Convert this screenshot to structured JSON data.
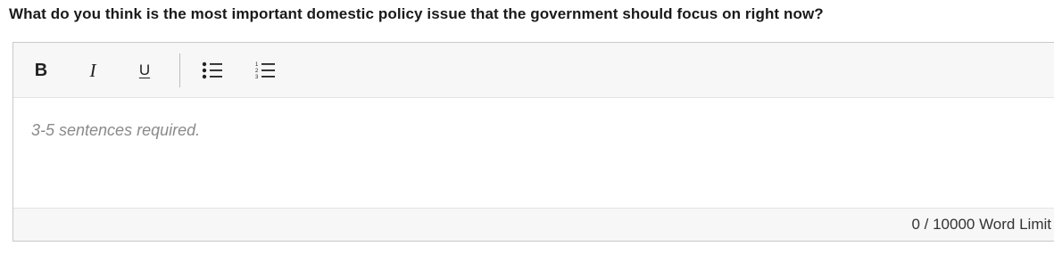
{
  "question": {
    "text": "What do you think is the most important domestic policy issue that the government should focus on right now?"
  },
  "toolbar": {
    "bold_label": "B",
    "italic_label": "I",
    "underline_label": "U",
    "bullet_list_icon": "bulleted-list-icon",
    "numbered_list_icon": "numbered-list-icon"
  },
  "editor": {
    "placeholder": "3-5 sentences required.",
    "value": ""
  },
  "footer": {
    "word_count": "0 / 10000 Word Limit"
  }
}
